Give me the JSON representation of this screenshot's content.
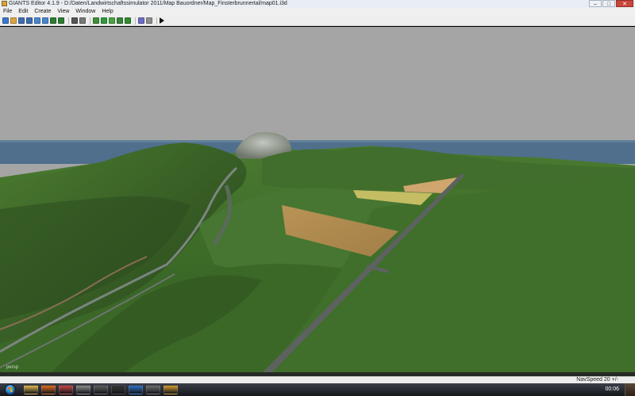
{
  "window": {
    "title": "GIANTS Editor 4.1.9 - D:/Daten/Landwirtschaftssimulator 2011/Map Bauordner/Map_Finsterbrunnertal/map01.i3d",
    "controls": [
      "–",
      "□",
      "✕"
    ]
  },
  "menu": {
    "items": [
      "File",
      "Edit",
      "Create",
      "View",
      "Window",
      "Help"
    ]
  },
  "toolbar": {
    "buttons": [
      {
        "name": "new-file-icon",
        "color": "#3d77c8"
      },
      {
        "name": "open-file-icon",
        "color": "#d9a441"
      },
      {
        "name": "save-icon",
        "color": "#3e6db0"
      },
      {
        "name": "save-all-icon",
        "color": "#3e6db0"
      },
      {
        "name": "import-icon",
        "color": "#4a86cf"
      },
      {
        "name": "export-icon",
        "color": "#4a86cf"
      },
      {
        "name": "undo-icon",
        "color": "#2e7d32"
      },
      {
        "name": "redo-icon",
        "color": "#2e7d32"
      },
      {
        "name": "select-icon",
        "color": "#555555"
      },
      {
        "name": "move-icon",
        "color": "#777777"
      },
      {
        "name": "terrain-sculpt-icon",
        "color": "#3f8f3a"
      },
      {
        "name": "terrain-paint-icon",
        "color": "#2e9a3d"
      },
      {
        "name": "foliage-paint-icon",
        "color": "#4aa43f"
      },
      {
        "name": "terrain-info-icon",
        "color": "#38843a"
      },
      {
        "name": "grass-icon",
        "color": "#2f8c2f"
      },
      {
        "name": "camera-icon",
        "color": "#6b6bc9"
      },
      {
        "name": "settings-icon",
        "color": "#8d8d8d"
      },
      {
        "name": "play-icon",
        "color": "#111111"
      }
    ]
  },
  "viewport": {
    "camera_label": "persp",
    "sky_color": "#a5a5a5",
    "water_color": "#4f6f8c",
    "grass_color": "#3d6b2a",
    "field_colors": [
      "#b2894e",
      "#c4bd63",
      "#cfa66e"
    ]
  },
  "status": {
    "nav_speed": "NavSpeed 20 +/-"
  },
  "taskbar": {
    "time": "00:06",
    "apps": [
      {
        "name": "explorer-taskbar-icon",
        "color": "#e0b54a"
      },
      {
        "name": "firefox-taskbar-icon",
        "color": "#e06a1b"
      },
      {
        "name": "app-taskbar-icon-3",
        "color": "#c74242"
      },
      {
        "name": "app-taskbar-icon-4",
        "color": "#8a8a8a"
      },
      {
        "name": "app-taskbar-icon-5",
        "color": "#5c5c5c"
      },
      {
        "name": "app-taskbar-icon-6",
        "color": "#333333"
      },
      {
        "name": "app-taskbar-icon-7",
        "color": "#2b6fc2"
      },
      {
        "name": "app-taskbar-icon-8",
        "color": "#6c6c6c"
      },
      {
        "name": "giants-editor-taskbar-icon",
        "color": "#d39a2a"
      }
    ]
  }
}
